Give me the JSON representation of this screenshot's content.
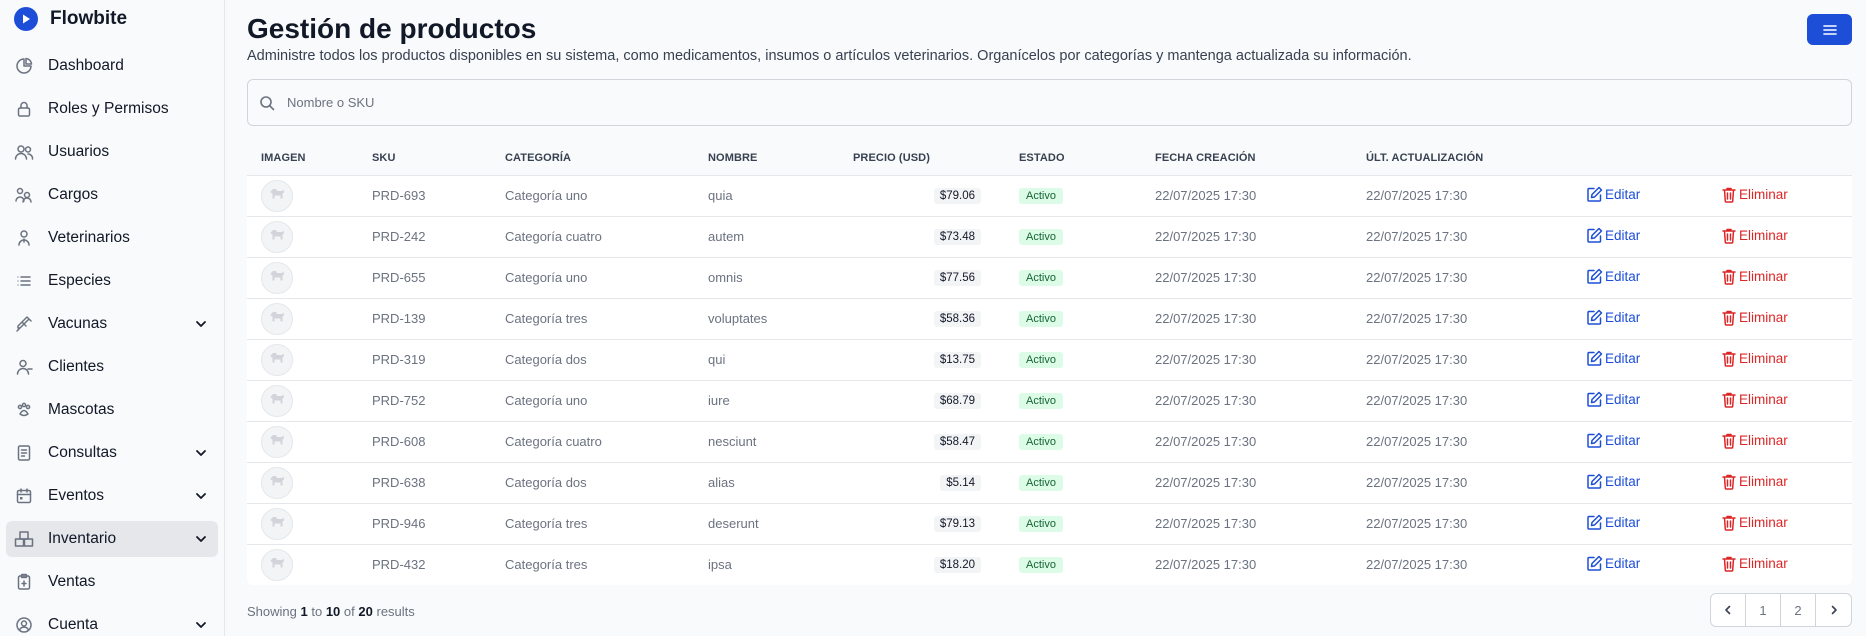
{
  "brand": {
    "name": "Flowbite",
    "icon": "play-logo-icon"
  },
  "sidebar": {
    "items": [
      {
        "label": "Dashboard",
        "icon": "chart-pie-icon",
        "chevron": false,
        "active": false
      },
      {
        "label": "Roles y Permisos",
        "icon": "lock-icon",
        "chevron": false,
        "active": false
      },
      {
        "label": "Usuarios",
        "icon": "users-icon",
        "chevron": false,
        "active": false
      },
      {
        "label": "Cargos",
        "icon": "cargo-icon",
        "chevron": false,
        "active": false
      },
      {
        "label": "Veterinarios",
        "icon": "stethoscope-icon",
        "chevron": false,
        "active": false
      },
      {
        "label": "Especies",
        "icon": "list-icon",
        "chevron": false,
        "active": false
      },
      {
        "label": "Vacunas",
        "icon": "syringe-icon",
        "chevron": true,
        "active": false
      },
      {
        "label": "Clientes",
        "icon": "user-icon",
        "chevron": false,
        "active": false
      },
      {
        "label": "Mascotas",
        "icon": "paw-icon",
        "chevron": false,
        "active": false
      },
      {
        "label": "Consultas",
        "icon": "document-icon",
        "chevron": true,
        "active": false
      },
      {
        "label": "Eventos",
        "icon": "calendar-icon",
        "chevron": true,
        "active": false
      },
      {
        "label": "Inventario",
        "icon": "boxes-icon",
        "chevron": true,
        "active": true
      },
      {
        "label": "Ventas",
        "icon": "clipboard-icon",
        "chevron": false,
        "active": false
      },
      {
        "label": "Cuenta",
        "icon": "user-circle-icon",
        "chevron": true,
        "active": false
      }
    ]
  },
  "header": {
    "title": "Gestión de productos",
    "description": "Administre todos los productos disponibles en su sistema, como medicamentos, insumos o artículos veterinarios. Organícelos por categorías y mantenga actualizada su información."
  },
  "search": {
    "placeholder": "Nombre o SKU",
    "value": ""
  },
  "table": {
    "columns": [
      "IMAGEN",
      "SKU",
      "CATEGORÍA",
      "NOMBRE",
      "PRECIO (USD)",
      "ESTADO",
      "FECHA CREACIÓN",
      "ÚLT. ACTUALIZACIÓN"
    ],
    "edit_label": "Editar",
    "delete_label": "Eliminar",
    "rows": [
      {
        "sku": "PRD-693",
        "category": "Categoría uno",
        "name": "quia",
        "price": "$79.06",
        "status": "Activo",
        "created": "22/07/2025 17:30",
        "updated": "22/07/2025 17:30"
      },
      {
        "sku": "PRD-242",
        "category": "Categoría cuatro",
        "name": "autem",
        "price": "$73.48",
        "status": "Activo",
        "created": "22/07/2025 17:30",
        "updated": "22/07/2025 17:30"
      },
      {
        "sku": "PRD-655",
        "category": "Categoría uno",
        "name": "omnis",
        "price": "$77.56",
        "status": "Activo",
        "created": "22/07/2025 17:30",
        "updated": "22/07/2025 17:30"
      },
      {
        "sku": "PRD-139",
        "category": "Categoría tres",
        "name": "voluptates",
        "price": "$58.36",
        "status": "Activo",
        "created": "22/07/2025 17:30",
        "updated": "22/07/2025 17:30"
      },
      {
        "sku": "PRD-319",
        "category": "Categoría dos",
        "name": "qui",
        "price": "$13.75",
        "status": "Activo",
        "created": "22/07/2025 17:30",
        "updated": "22/07/2025 17:30"
      },
      {
        "sku": "PRD-752",
        "category": "Categoría uno",
        "name": "iure",
        "price": "$68.79",
        "status": "Activo",
        "created": "22/07/2025 17:30",
        "updated": "22/07/2025 17:30"
      },
      {
        "sku": "PRD-608",
        "category": "Categoría cuatro",
        "name": "nesciunt",
        "price": "$58.47",
        "status": "Activo",
        "created": "22/07/2025 17:30",
        "updated": "22/07/2025 17:30"
      },
      {
        "sku": "PRD-638",
        "category": "Categoría dos",
        "name": "alias",
        "price": "$5.14",
        "status": "Activo",
        "created": "22/07/2025 17:30",
        "updated": "22/07/2025 17:30"
      },
      {
        "sku": "PRD-946",
        "category": "Categoría tres",
        "name": "deserunt",
        "price": "$79.13",
        "status": "Activo",
        "created": "22/07/2025 17:30",
        "updated": "22/07/2025 17:30"
      },
      {
        "sku": "PRD-432",
        "category": "Categoría tres",
        "name": "ipsa",
        "price": "$18.20",
        "status": "Activo",
        "created": "22/07/2025 17:30",
        "updated": "22/07/2025 17:30"
      }
    ]
  },
  "footer": {
    "showing": "Showing",
    "from": "1",
    "to_word": "to",
    "to": "10",
    "of_word": "of",
    "total": "20",
    "results": "results"
  },
  "pagination": {
    "prev_icon": "chevron-left-icon",
    "pages": [
      "1",
      "2"
    ],
    "next_icon": "chevron-right-icon"
  },
  "colors": {
    "accent": "#1d4ed8",
    "danger": "#dc2626",
    "success_bg": "#dcfce7",
    "success_text": "#166534"
  }
}
